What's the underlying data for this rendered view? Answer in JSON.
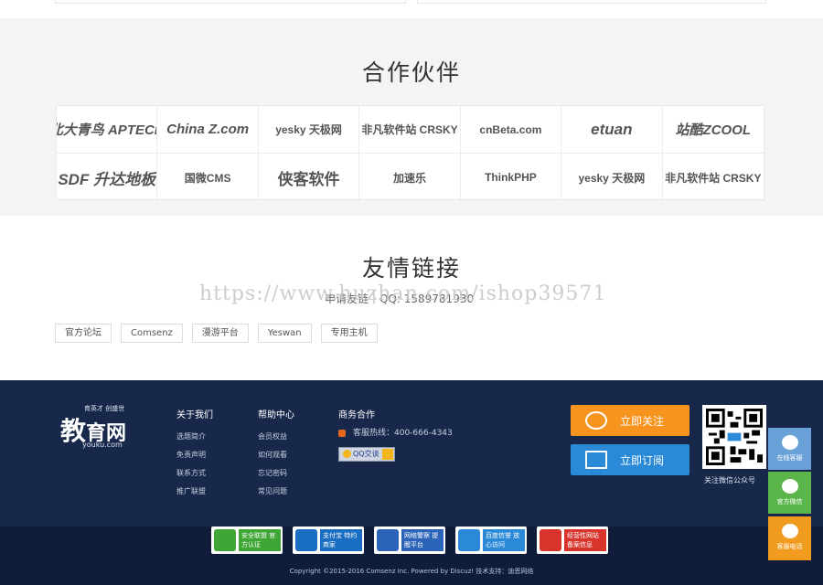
{
  "partners": {
    "title": "合作伙伴",
    "items": [
      "北大青鸟 APTECH",
      "China Z.com",
      "yesky 天极网",
      "非凡软件站 CRSKY",
      "cnBeta.com",
      "etuan",
      "站酷ZCOOL",
      "SDF 升达地板",
      "国微CMS",
      "侠客软件",
      "加速乐",
      "ThinkPHP",
      "yesky 天极网",
      "非凡软件站 CRSKY"
    ]
  },
  "links": {
    "title": "友情链接",
    "watermark": "https://www.huzhan.com/ishop39571",
    "apply": "申请友链｜QQ: 1589781930",
    "items": [
      "官方论坛",
      "Comsenz",
      "漫游平台",
      "Yeswan",
      "专用主机"
    ]
  },
  "footer": {
    "logo": {
      "slogan": "育英才 创盛世",
      "main_big": "教",
      "main_rest": "育网",
      "domain": "youku.com"
    },
    "about": {
      "title": "关于我们",
      "items": [
        "选题简介",
        "免责声明",
        "联系方式",
        "推广联盟"
      ]
    },
    "help": {
      "title": "帮助中心",
      "items": [
        "会员权益",
        "如何观看",
        "忘记密码",
        "常见问题"
      ]
    },
    "business": {
      "title": "商务合作",
      "hotline": "客服热线：400-666-4343",
      "qq_label": "QQ交谈"
    },
    "follow_label": "立即关注",
    "subscribe_label": "立即订阅",
    "qr_caption": "关注微信公众号"
  },
  "badges": [
    {
      "text": "安全联盟 官方认证",
      "color": "#3fa535"
    },
    {
      "text": "支付宝 特约商家",
      "color": "#1a6ec2"
    },
    {
      "text": "网络警察 提醒平台",
      "color": "#2a63b8"
    },
    {
      "text": "百度信誉 放心访问",
      "color": "#2b8ad8"
    },
    {
      "text": "经营性网站 备案信息",
      "color": "#d9342b"
    }
  ],
  "copyright": "Copyright ©2015-2016 Comsenz Inc. Powered by Discuz! 技术支持：迪恩网络",
  "side": {
    "online": "在线客服",
    "wechat": "官方微信",
    "phone": "客服电话"
  },
  "colors": {
    "footer_bg": "#17284a",
    "follow": "#f7941e",
    "subscribe": "#2b8ad8"
  }
}
